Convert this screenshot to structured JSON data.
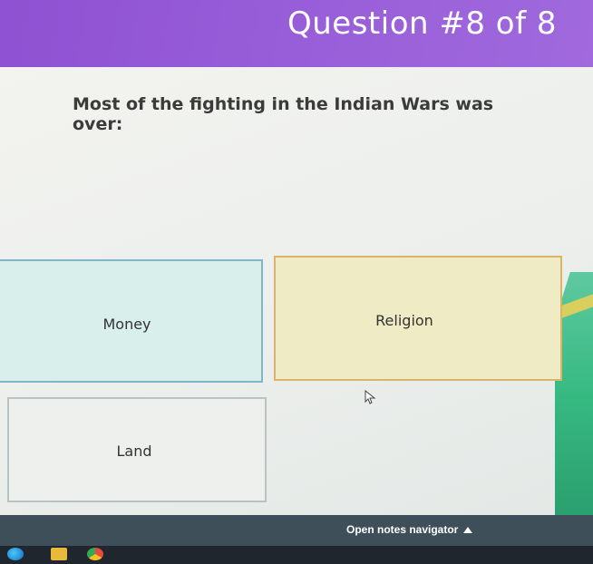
{
  "header": {
    "title": "Question #8 of 8"
  },
  "question": {
    "text": "Most of the fighting in the Indian Wars was over:"
  },
  "choices": [
    {
      "label": "Money"
    },
    {
      "label": "Religion"
    },
    {
      "label": "Land"
    }
  ],
  "footer": {
    "navigator_label": "Open notes navigator"
  },
  "colors": {
    "header": "#9a60da",
    "money_card": "#d9efeb",
    "religion_card": "#efebc4",
    "land_card": "#eef0ee",
    "footer": "#3e4f5a"
  }
}
